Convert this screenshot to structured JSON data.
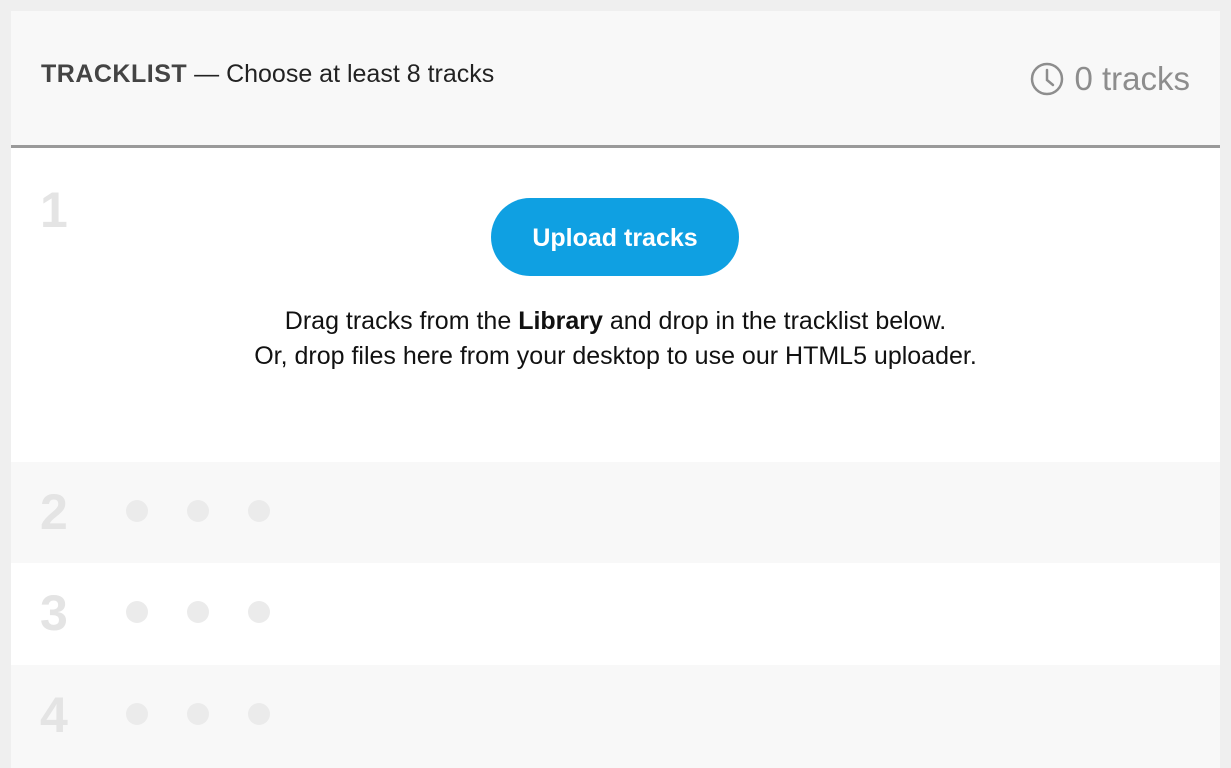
{
  "header": {
    "title": "TRACKLIST",
    "separator": " — ",
    "subtitle": "Choose at least 8 tracks",
    "count_label": "0 tracks",
    "count_icon": "clock-icon"
  },
  "slots": [
    {
      "number": "1"
    },
    {
      "number": "2"
    },
    {
      "number": "3"
    },
    {
      "number": "4"
    }
  ],
  "upload": {
    "button_label": "Upload tracks",
    "help_line1_prefix": "Drag tracks from the ",
    "help_line1_strong": "Library",
    "help_line1_suffix": " and drop in the tracklist below.",
    "help_line2": "Or, drop files here from your desktop to use our HTML5 uploader."
  },
  "colors": {
    "accent": "#0fa0e2",
    "header_bg": "#f8f8f8",
    "muted": "#8d8d8d"
  }
}
